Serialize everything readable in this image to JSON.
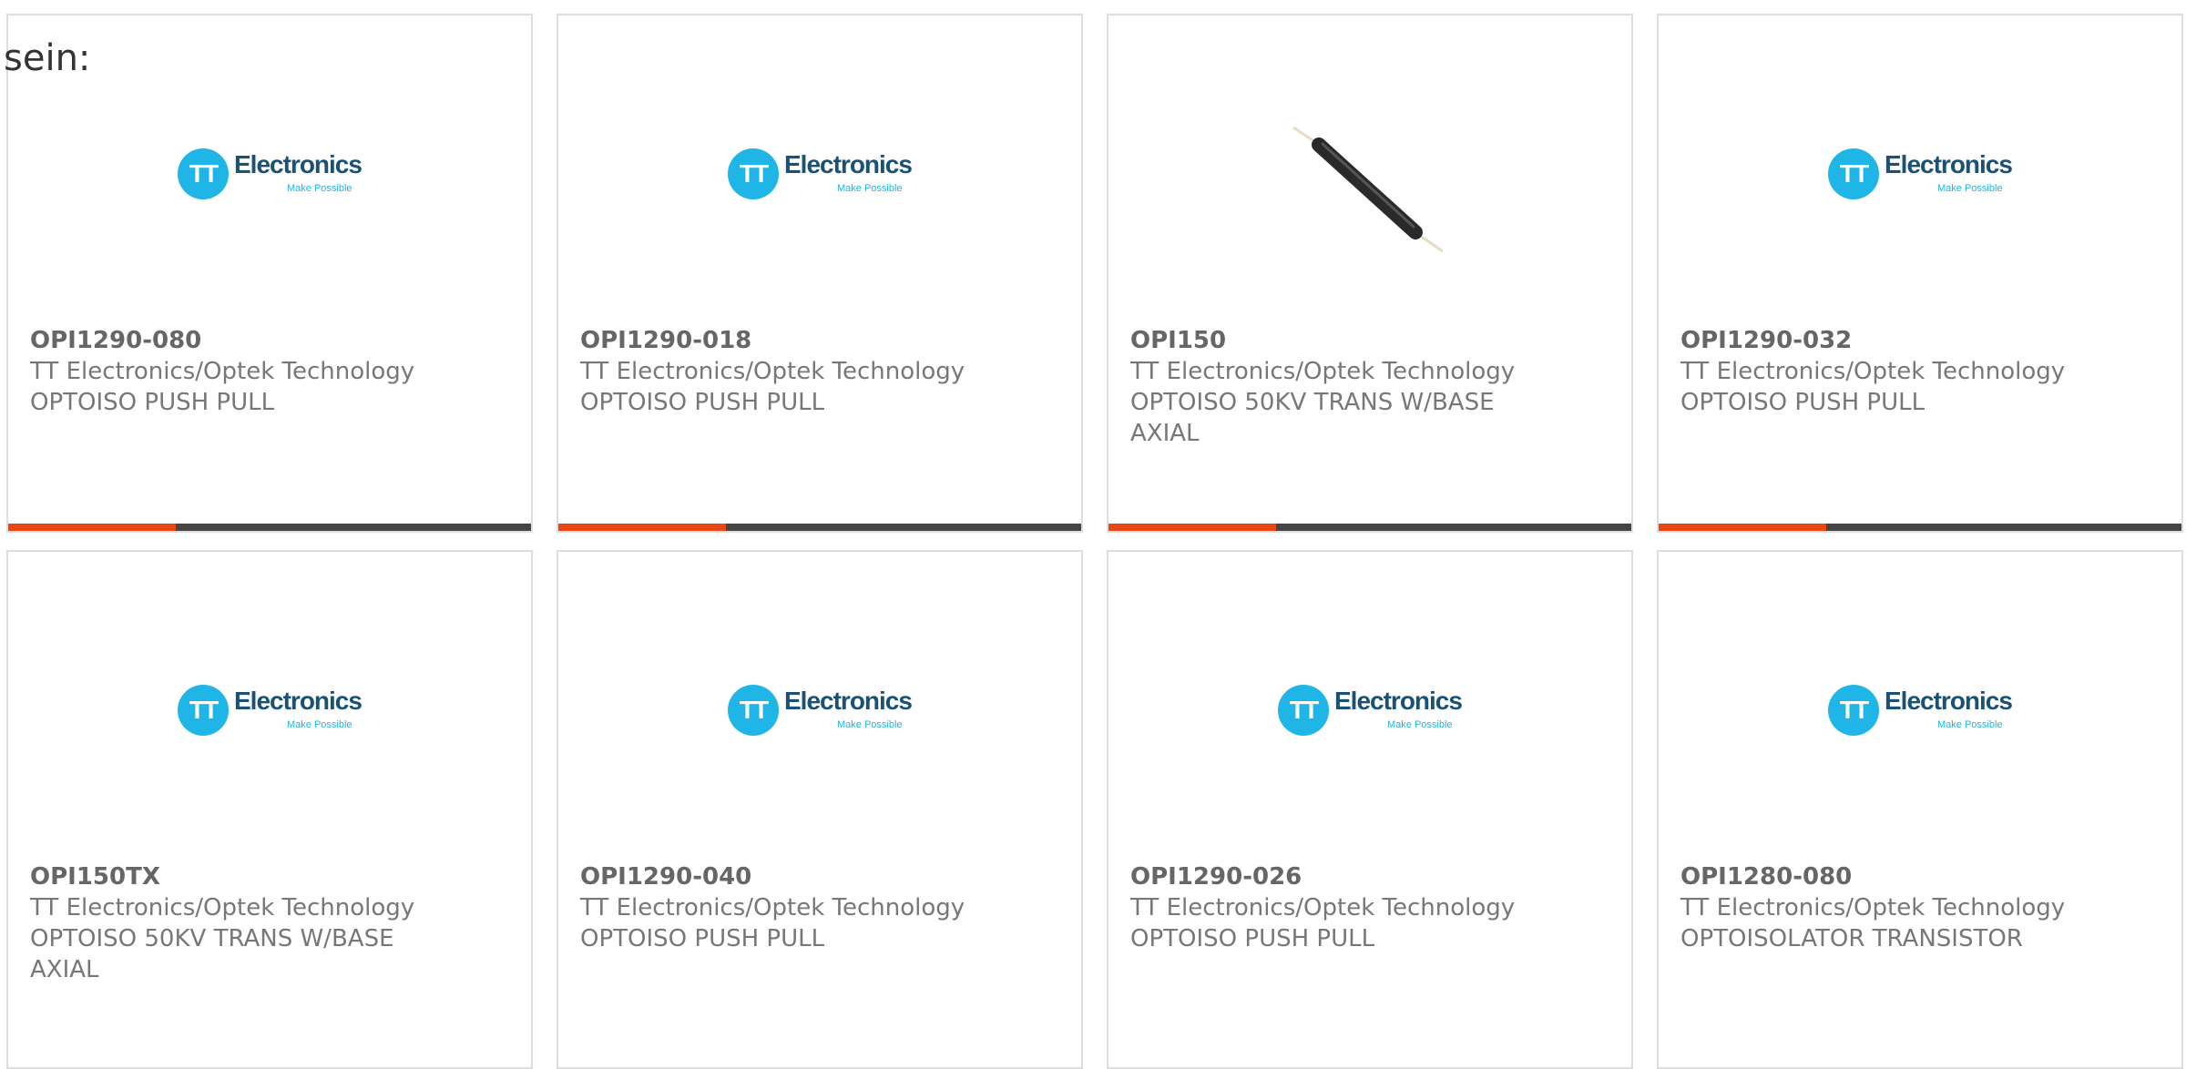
{
  "prefix_text": "sein:",
  "colors": {
    "accent": "#e84715",
    "bar": "#444444",
    "logo_blue": "#1fb5e6",
    "logo_dark": "#1a5276"
  },
  "logo": {
    "initials": "TT",
    "word": "Electronics",
    "tagline": "Make Possible"
  },
  "products": [
    {
      "part": "OPI1290-080",
      "manufacturer": "TT Electronics/Optek Technology",
      "description": "OPTOISO PUSH PULL",
      "image": "tt-electronics-logo",
      "accent_fraction": 0.32
    },
    {
      "part": "OPI1290-018",
      "manufacturer": "TT Electronics/Optek Technology",
      "description": "OPTOISO PUSH PULL",
      "image": "tt-electronics-logo",
      "accent_fraction": 0.32
    },
    {
      "part": "OPI150",
      "manufacturer": "TT Electronics/Optek Technology",
      "description": "OPTOISO 50KV TRANS W/BASE AXIAL",
      "image": "axial-component-photo",
      "accent_fraction": 0.32
    },
    {
      "part": "OPI1290-032",
      "manufacturer": "TT Electronics/Optek Technology",
      "description": "OPTOISO PUSH PULL",
      "image": "tt-electronics-logo",
      "accent_fraction": 0.32
    },
    {
      "part": "OPI150TX",
      "manufacturer": "TT Electronics/Optek Technology",
      "description": "OPTOISO 50KV TRANS W/BASE AXIAL",
      "image": "tt-electronics-logo"
    },
    {
      "part": "OPI1290-040",
      "manufacturer": "TT Electronics/Optek Technology",
      "description": "OPTOISO PUSH PULL",
      "image": "tt-electronics-logo"
    },
    {
      "part": "OPI1290-026",
      "manufacturer": "TT Electronics/Optek Technology",
      "description": "OPTOISO PUSH PULL",
      "image": "tt-electronics-logo"
    },
    {
      "part": "OPI1280-080",
      "manufacturer": "TT Electronics/Optek Technology",
      "description": "OPTOISOLATOR TRANSISTOR",
      "image": "tt-electronics-logo"
    }
  ]
}
